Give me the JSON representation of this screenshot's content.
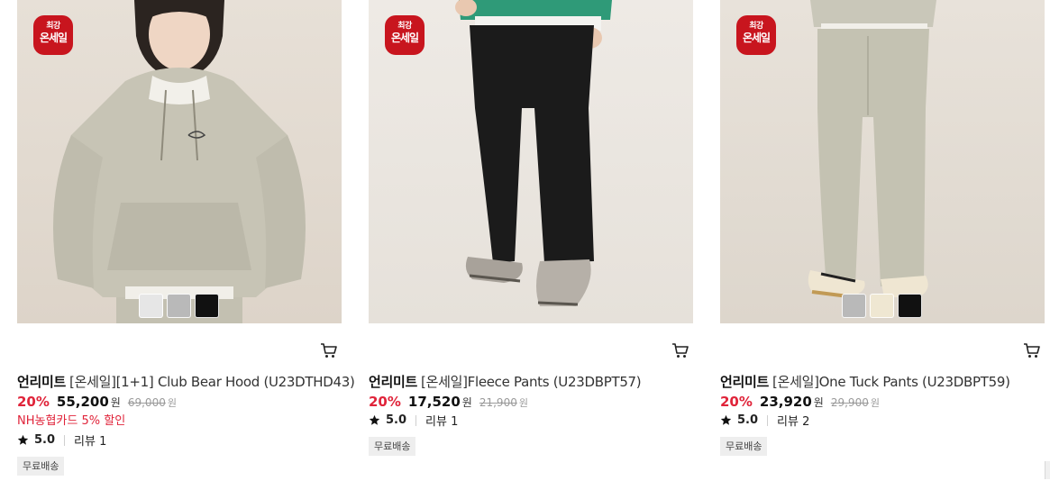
{
  "products": [
    {
      "badge": {
        "line1": "최강",
        "line2": "온세일",
        "color": "#c8151e"
      },
      "brand": "언리미트",
      "name": "[온세일][1+1] Club Bear Hood (U23DTHD43)",
      "discount": "20%",
      "price": "55,200",
      "price_unit": "원",
      "original_price": "69,000",
      "original_unit": "원",
      "promo": "NH농협카드 5% 할인",
      "rating": "5.0",
      "reviews": "리뷰 1",
      "shipping_tag": "무료배송",
      "swatches": [
        "#e6e6e6",
        "#b9b9b9",
        "#111111"
      ],
      "cart_icon": "cart-icon",
      "image": "model-gray-hoodie"
    },
    {
      "badge": {
        "line1": "최강",
        "line2": "온세일",
        "color": "#c8151e"
      },
      "brand": "언리미트",
      "name": "[온세일]Fleece Pants (U23DBPT57)",
      "discount": "20%",
      "price": "17,520",
      "price_unit": "원",
      "original_price": "21,900",
      "original_unit": "원",
      "rating": "5.0",
      "reviews": "리뷰 1",
      "shipping_tag": "무료배송",
      "cart_icon": "cart-icon",
      "image": "model-black-pants"
    },
    {
      "badge": {
        "line1": "최강",
        "line2": "온세일",
        "color": "#c8151e"
      },
      "brand": "언리미트",
      "name": "[온세일]One Tuck Pants (U23DBPT59)",
      "discount": "20%",
      "price": "23,920",
      "price_unit": "원",
      "original_price": "29,900",
      "original_unit": "원",
      "rating": "5.0",
      "reviews": "리뷰 2",
      "shipping_tag": "무료배송",
      "swatches": [
        "#b9b9b9",
        "#efe7d2",
        "#111111"
      ],
      "cart_icon": "cart-icon",
      "image": "model-gray-pants"
    }
  ],
  "colors": {
    "accent_red": "#e0243a",
    "badge_red": "#c8151e",
    "tag_bg": "#eeeeee"
  }
}
